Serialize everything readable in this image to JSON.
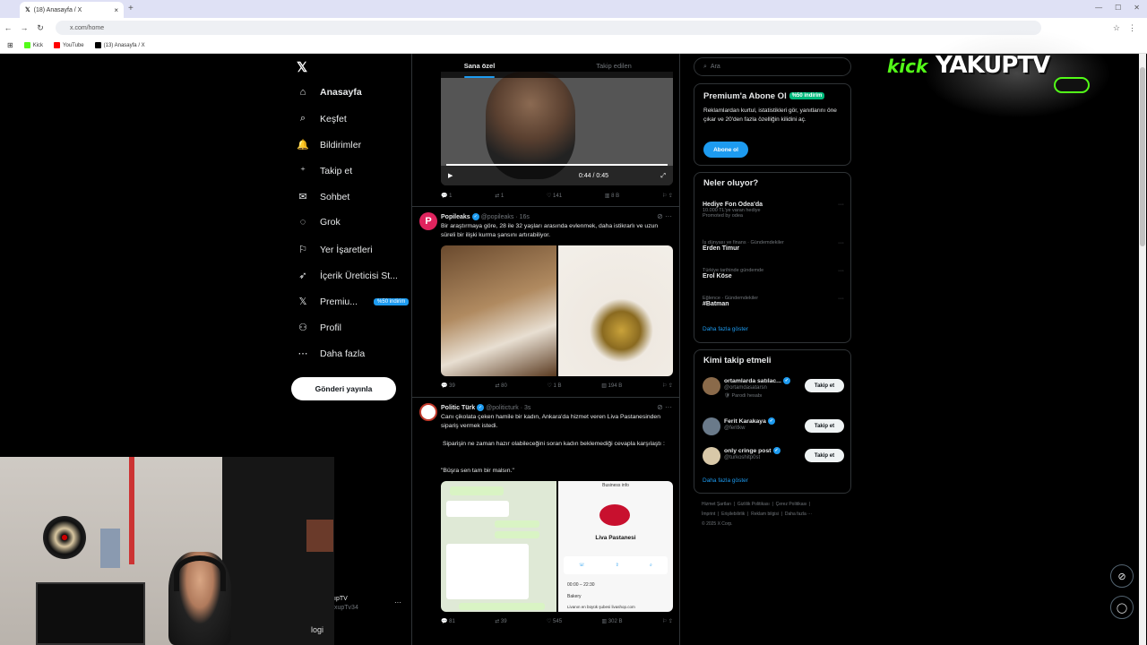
{
  "browser": {
    "tab_title": "(18) Anasayfa / X",
    "url": "x.com/home",
    "bookmarks": [
      {
        "label": "Kick",
        "color": "#53fc18"
      },
      {
        "label": "YouTube",
        "color": "#ff0000"
      },
      {
        "label": "(13) Anasayfa / X",
        "color": "#000000"
      }
    ]
  },
  "nav": {
    "items": [
      {
        "label": "Anasayfa",
        "icon": "home-icon",
        "glyph": "⌂"
      },
      {
        "label": "Keşfet",
        "icon": "search-icon",
        "glyph": "⌕"
      },
      {
        "label": "Bildirimler",
        "icon": "bell-icon",
        "glyph": "🔔"
      },
      {
        "label": "Takip et",
        "icon": "follow-icon",
        "glyph": "⁺"
      },
      {
        "label": "Sohbet",
        "icon": "mail-icon",
        "glyph": "✉"
      },
      {
        "label": "Grok",
        "icon": "grok-icon",
        "glyph": "◌"
      },
      {
        "label": "Yer İşaretleri",
        "icon": "bookmark-icon",
        "glyph": "⚐"
      },
      {
        "label": "İçerik Üreticisi St...",
        "icon": "rocket-icon",
        "glyph": "➶"
      },
      {
        "label": "Premiu...",
        "icon": "x-premium-icon",
        "glyph": "𝕏"
      },
      {
        "label": "Profil",
        "icon": "profile-icon",
        "glyph": "⚇"
      },
      {
        "label": "Daha fazla",
        "icon": "more-icon",
        "glyph": "⋯"
      }
    ],
    "premium_badge": "%50 indirim",
    "post_button": "Gönderi yayınla",
    "mini_profile_name": "ıpTV",
    "mini_profile_handle": "xupTv34"
  },
  "feed": {
    "tabs": [
      "Sana özel",
      "Takip edilen"
    ],
    "video": {
      "time": "0:44 / 0:45",
      "progress": 0.98
    },
    "video_actions": [
      "1",
      "1",
      "141",
      "8 B"
    ],
    "tweets": [
      {
        "name": "Popileaks",
        "handle": "@popileaks · 16s",
        "text": "Bir araştırmaya göre, 28 ile 32 yaşları arasında evlenmek, daha istikrarlı ve uzun süreli bir ilişki kurma şansını artırabiliyor.",
        "actions": [
          "39",
          "80",
          "1 B",
          "194 B"
        ]
      },
      {
        "name": "Politic Türk",
        "handle": "@politicturk · 3s",
        "text1": "Canı çikolata çeken hamile bir kadın, Ankara'da hizmet veren Liva Pastanesinden sipariş vermek istedi.",
        "text2": "Siparişin ne zaman hazır olabileceğini soran kadın beklemediği cevapla karşılaştı :",
        "text3": "\"Büşra sen tam bir malsın.\"",
        "image_text": {
          "business_info": "Business info",
          "shop": "Liva Pastanesi",
          "bakery": "Bakery",
          "hours": "00:00 – 22:30",
          "footer": "Livanın en büyük şubesi livashop.com"
        },
        "actions": [
          "81",
          "39",
          "545",
          "302 B"
        ]
      }
    ]
  },
  "sidebar": {
    "search_placeholder": "Ara",
    "premium": {
      "title": "Premium'a Abone Ol",
      "badge": "%50 indirim",
      "text": "Reklamlardan kurtul, istatistikleri gör, yanıtlarını öne çıkar ve 20'den fazla özelliğin kilidini aç.",
      "button": "Abone ol"
    },
    "trends": {
      "title": "Neler oluyor?",
      "items": [
        {
          "meta": "",
          "name": "Hediye Fon Odea'da",
          "sub": "10.000 TL'ye varan hediye",
          "promo": "Promoted by odea"
        },
        {
          "meta": "İş dünyası ve finans · Gündemdekiler",
          "name": "Erden Timur",
          "sub": "",
          "promo": ""
        },
        {
          "meta": "Türkiye tarihinde gündemde",
          "name": "Erol Köse",
          "sub": "",
          "promo": ""
        },
        {
          "meta": "Eğlence · Gündemdekiler",
          "name": "#Batman",
          "sub": "",
          "promo": ""
        }
      ],
      "show_more": "Daha fazla göster"
    },
    "who_to_follow": {
      "title": "Kimi takip etmeli",
      "items": [
        {
          "name": "ortamlarda satılac...",
          "handle": "@ortamdasatarsn",
          "extra": "Parodi hesabı",
          "button": "Takip et"
        },
        {
          "name": "Ferit Karakaya",
          "handle": "@feritkw",
          "extra": "",
          "button": "Takip et"
        },
        {
          "name": "only cringe post",
          "handle": "@turkoshitp0st",
          "extra": "",
          "button": "Takip et"
        }
      ],
      "show_more": "Daha fazla göster"
    },
    "footer": [
      "Hizmet Şartları",
      "Gizlilik Politikası",
      "Çerez Politikası",
      "İmprint",
      "Erişilebilirlik",
      "Reklam bilgisi",
      "Daha fazla ···",
      "© 2025 X Corp."
    ]
  },
  "overlay": {
    "kick": "kick",
    "brand": "YAKUPTV",
    "webcam_label": "logi"
  },
  "colors": {
    "accent": "#1d9bf0",
    "green": "#00ba7c",
    "kick": "#53fc18"
  }
}
